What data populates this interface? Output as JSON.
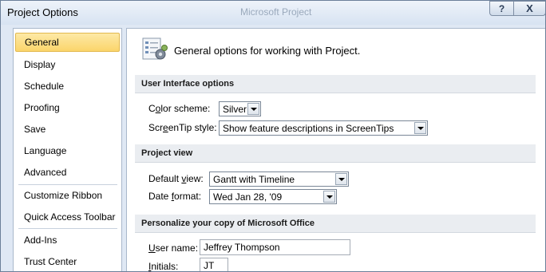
{
  "window": {
    "title": "Project Options",
    "background_app_title": "Microsoft Project",
    "help_glyph": "?",
    "close_glyph": "X"
  },
  "sidebar": {
    "items": [
      {
        "label": "General",
        "active": true
      },
      {
        "label": "Display"
      },
      {
        "label": "Schedule"
      },
      {
        "label": "Proofing"
      },
      {
        "label": "Save"
      },
      {
        "label": "Language"
      },
      {
        "label": "Advanced"
      },
      {
        "label": "Customize Ribbon"
      },
      {
        "label": "Quick Access Toolbar"
      },
      {
        "label": "Add-Ins"
      },
      {
        "label": "Trust Center"
      }
    ]
  },
  "main": {
    "header_text": "General options for working with Project.",
    "header_icon": "options-settings-icon",
    "ui_section": {
      "title": "User Interface options",
      "color_scheme": {
        "label_pre": "C",
        "label_acc": "o",
        "label_post": "lor scheme:",
        "value": "Silver"
      },
      "screentip": {
        "label_pre": "Scr",
        "label_acc": "e",
        "label_post": "enTip style:",
        "value": "Show feature descriptions in ScreenTips"
      }
    },
    "view_section": {
      "title": "Project view",
      "default_view": {
        "label_pre": "Default ",
        "label_acc": "v",
        "label_post": "iew:",
        "value": "Gantt with Timeline"
      },
      "date_format": {
        "label_pre": "Date ",
        "label_acc": "f",
        "label_post": "ormat:",
        "value": "Wed Jan 28, '09"
      }
    },
    "personalize_section": {
      "title": "Personalize your copy of Microsoft Office",
      "user_name": {
        "label_pre": "",
        "label_acc": "U",
        "label_post": "ser name:",
        "value": "Jeffrey Thompson"
      },
      "initials": {
        "label_pre": "",
        "label_acc": "I",
        "label_post": "nitials:",
        "value": "JT"
      }
    }
  },
  "colors": {
    "active_nav_top": "#fde9a6",
    "active_nav_bottom": "#fbd56b",
    "frame": "#dfe8f4"
  }
}
